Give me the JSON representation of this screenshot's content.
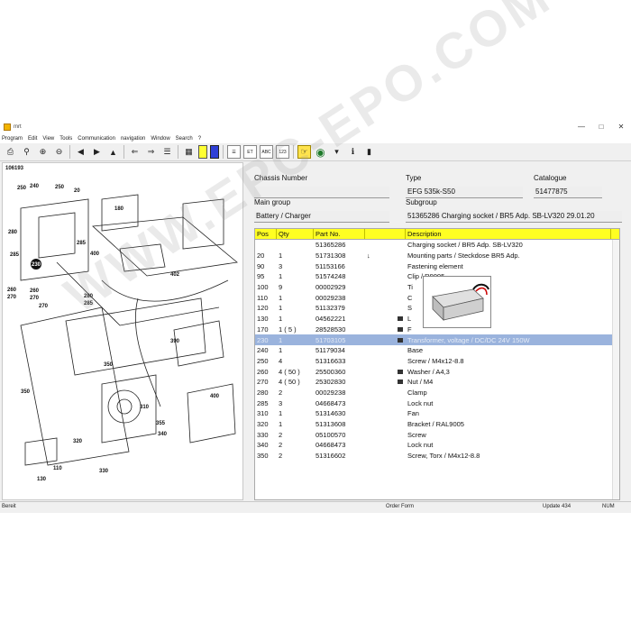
{
  "window": {
    "title": "mrt",
    "controls": [
      "—",
      "□",
      "✕"
    ]
  },
  "menu": [
    "Program",
    "Edit",
    "View",
    "Tools",
    "Communication",
    "navigation",
    "Window",
    "Search",
    "?"
  ],
  "drawing": {
    "id": "106193",
    "callouts": [
      "250",
      "240",
      "250",
      "20",
      "280",
      "285",
      "230",
      "260",
      "260",
      "270",
      "270",
      "270",
      "280",
      "285",
      "285",
      "400",
      "402",
      "390",
      "350",
      "350",
      "310",
      "355",
      "340",
      "320",
      "400",
      "330",
      "130",
      "110",
      "180"
    ]
  },
  "header": {
    "chassis_label": "Chassis Number",
    "chassis_value": "",
    "type_label": "Type",
    "type_value": "EFG 535k-S50",
    "catalogue_label": "Catalogue",
    "catalogue_value": "51477875",
    "maingroup_label": "Main group",
    "maingroup_value": "Battery / Charger",
    "subgroup_label": "Subgroup",
    "subgroup_value": "51365286  Charging socket / BR5 Adp. SB-LV320 29.01.20"
  },
  "grid": {
    "columns": [
      "Pos",
      "Qty",
      "Part No.",
      "",
      "Description"
    ],
    "rows": [
      {
        "pos": "",
        "qty": "",
        "part": "51365286",
        "mark": "",
        "icon": false,
        "desc": "Charging socket / BR5 Adp. SB-LV320"
      },
      {
        "pos": "20",
        "qty": "1",
        "part": "51731308",
        "mark": "↓",
        "icon": false,
        "desc": "Mounting parts / Steckdose BR5 Adp."
      },
      {
        "pos": "90",
        "qty": "3",
        "part": "51153166",
        "mark": "",
        "icon": false,
        "desc": "Fastening element"
      },
      {
        "pos": "95",
        "qty": "1",
        "part": "51574248",
        "mark": "",
        "icon": false,
        "desc": "Clip / R9005"
      },
      {
        "pos": "100",
        "qty": "9",
        "part": "00002929",
        "mark": "",
        "icon": false,
        "desc": "Ti"
      },
      {
        "pos": "110",
        "qty": "1",
        "part": "00029238",
        "mark": "",
        "icon": false,
        "desc": "C"
      },
      {
        "pos": "120",
        "qty": "1",
        "part": "51132379",
        "mark": "",
        "icon": false,
        "desc": "S"
      },
      {
        "pos": "130",
        "qty": "1",
        "part": "04562221",
        "mark": "",
        "icon": true,
        "desc": "L"
      },
      {
        "pos": "170",
        "qty": "1   ( 5 )",
        "part": "28528530",
        "mark": "",
        "icon": true,
        "desc": "F"
      },
      {
        "pos": "230",
        "qty": "1",
        "part": "51703105",
        "mark": "",
        "icon": true,
        "desc": "Transformer, voltage / DC/DC 24V 150W",
        "selected": true
      },
      {
        "pos": "240",
        "qty": "1",
        "part": "51179034",
        "mark": "",
        "icon": false,
        "desc": "Base"
      },
      {
        "pos": "250",
        "qty": "4",
        "part": "51316633",
        "mark": "",
        "icon": false,
        "desc": "Screw / M4x12-8.8"
      },
      {
        "pos": "260",
        "qty": "4   ( 50 )",
        "part": "25500360",
        "mark": "",
        "icon": true,
        "desc": "Washer / A4,3"
      },
      {
        "pos": "270",
        "qty": "4   ( 50 )",
        "part": "25302830",
        "mark": "",
        "icon": true,
        "desc": "Nut / M4"
      },
      {
        "pos": "280",
        "qty": "2",
        "part": "00029238",
        "mark": "",
        "icon": false,
        "desc": "Clamp"
      },
      {
        "pos": "285",
        "qty": "3",
        "part": "04668473",
        "mark": "",
        "icon": false,
        "desc": "Lock nut"
      },
      {
        "pos": "310",
        "qty": "1",
        "part": "51314630",
        "mark": "",
        "icon": false,
        "desc": "Fan"
      },
      {
        "pos": "320",
        "qty": "1",
        "part": "51313608",
        "mark": "",
        "icon": false,
        "desc": "Bracket / RAL9005"
      },
      {
        "pos": "330",
        "qty": "2",
        "part": "05100570",
        "mark": "",
        "icon": false,
        "desc": "Screw"
      },
      {
        "pos": "340",
        "qty": "2",
        "part": "04668473",
        "mark": "",
        "icon": false,
        "desc": "Lock nut"
      },
      {
        "pos": "350",
        "qty": "2",
        "part": "51316602",
        "mark": "",
        "icon": false,
        "desc": "Screw, Torx / M4x12-8.8"
      }
    ]
  },
  "status": {
    "left": "Bereit",
    "mid": "Order Form",
    "update": "Update 434",
    "num": "NUM"
  },
  "watermark": "WWW.EPC-EPO.COM",
  "colors": {
    "header_yellow": "#ffff22",
    "selection": "#9ab3dd"
  }
}
